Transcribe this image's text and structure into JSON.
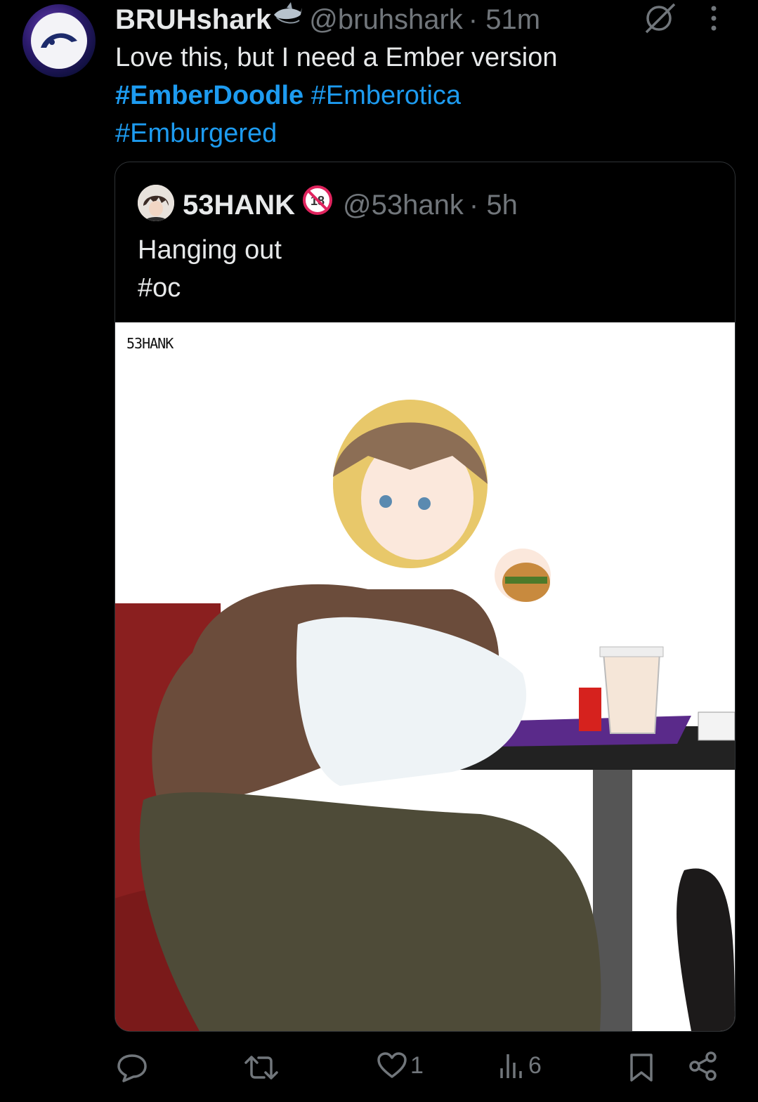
{
  "tweet": {
    "author_name": "BRUHshark",
    "author_handle": "@bruhshark",
    "time": "· 51m",
    "text": "Love this, but I need a Ember version",
    "hashtags": [
      "#EmberDoodle",
      "#Emberotica",
      "#Emburgered"
    ]
  },
  "quote": {
    "author_name": "53HANK",
    "author_handle": "@53hank",
    "time": "· 5h",
    "text_line1": "Hanging out",
    "text_line2": "#oc",
    "image_signature": "53HANK"
  },
  "actions": {
    "reply_count": "",
    "retweet_count": "",
    "like_count": "1",
    "views_count": "6"
  },
  "icons": [
    "grok-icon",
    "more-icon",
    "reply-icon",
    "retweet-icon",
    "like-icon",
    "views-icon",
    "bookmark-icon",
    "share-icon",
    "shark-emoji-icon",
    "adult-badge-icon"
  ],
  "colors": {
    "link": "#1d9bf0",
    "muted": "#71767b",
    "text": "#e7e9ea",
    "background": "#000000"
  }
}
